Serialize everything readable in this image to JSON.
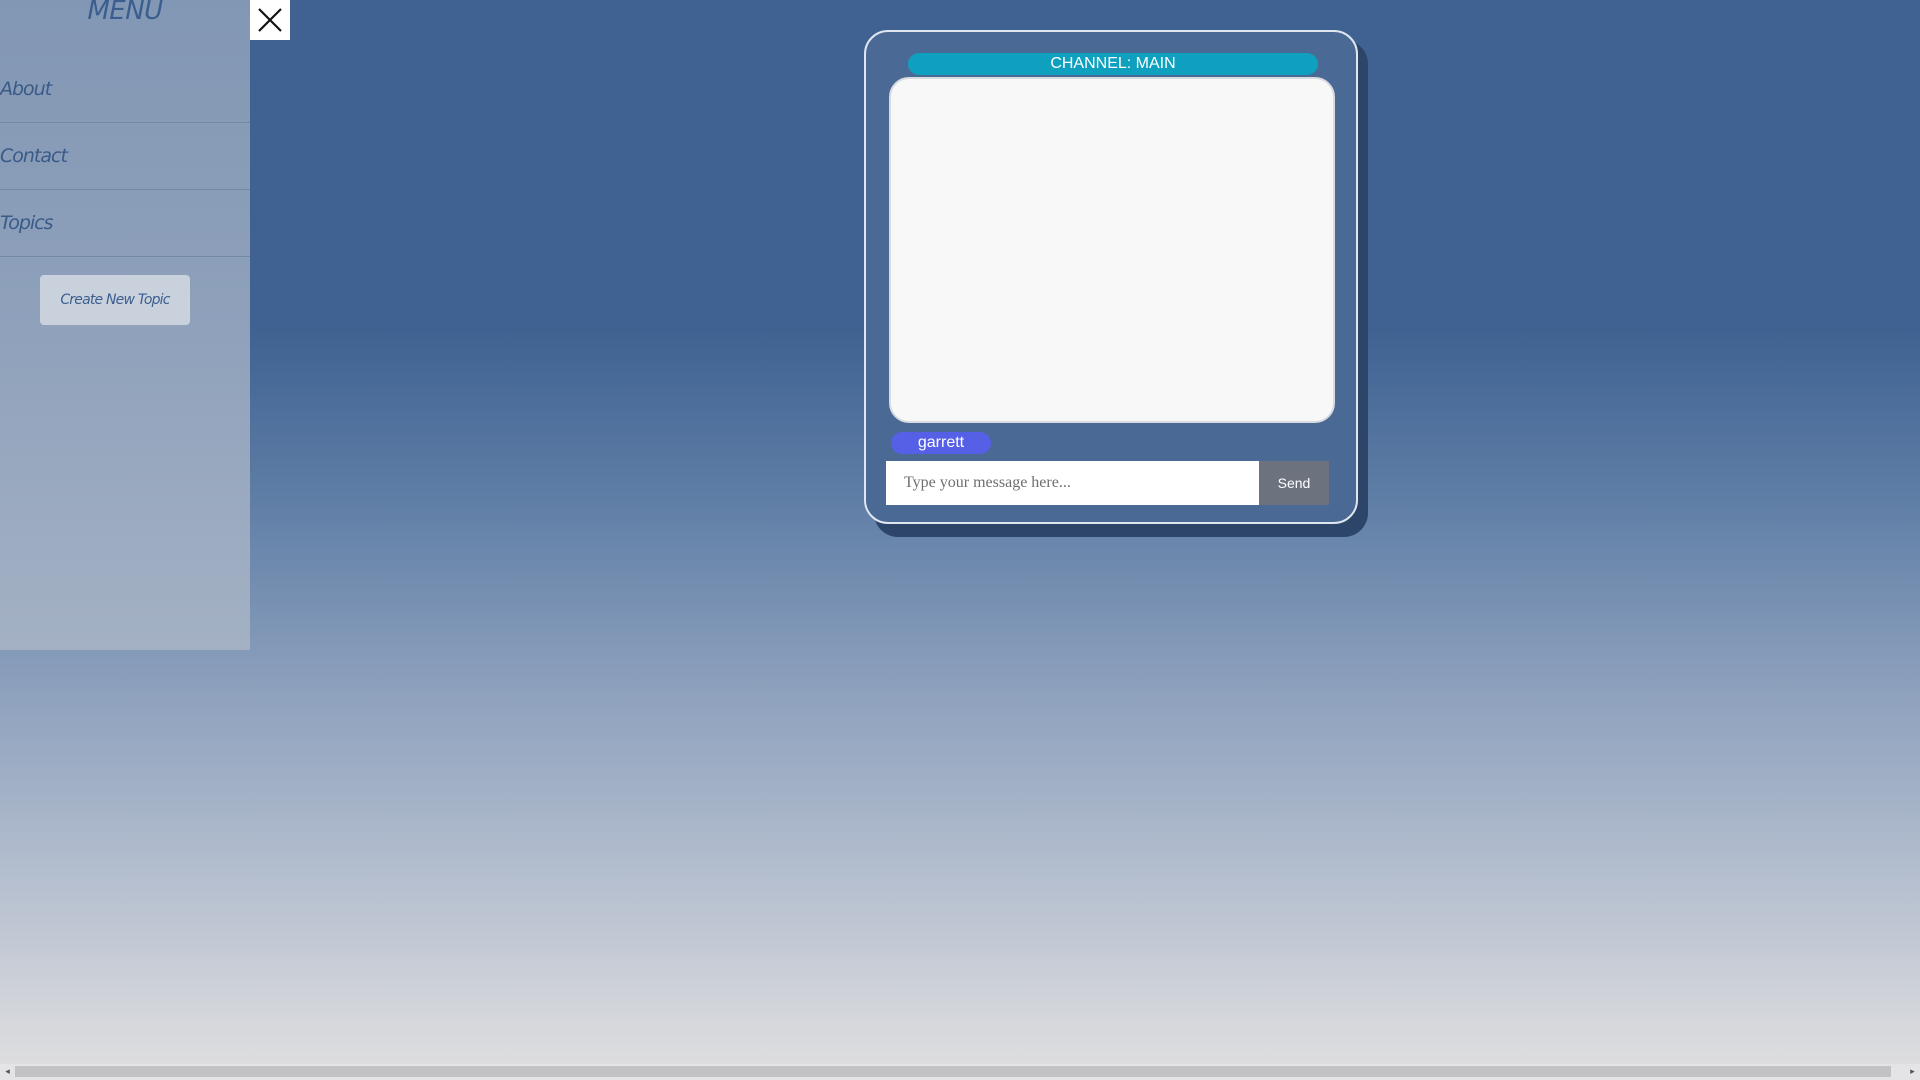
{
  "sidebar": {
    "title": "MENU",
    "items": [
      {
        "label": "About"
      },
      {
        "label": "Contact"
      },
      {
        "label": "Topics"
      }
    ],
    "create_button_label": "Create New Topic"
  },
  "close_button": {
    "icon": "close-icon"
  },
  "chat": {
    "channel_label": "CHANNEL: MAIN",
    "username": "garrett",
    "input_placeholder": "Type your message here...",
    "input_value": "",
    "send_label": "Send"
  },
  "scrollbar": {
    "left_arrow": "◂",
    "right_arrow": "▸"
  },
  "colors": {
    "background_top": "#3f6292",
    "background_bottom": "#dfdfe1",
    "channel_header": "#0ea0be",
    "username_badge": "#5660e6",
    "send_button": "#6c737f"
  }
}
